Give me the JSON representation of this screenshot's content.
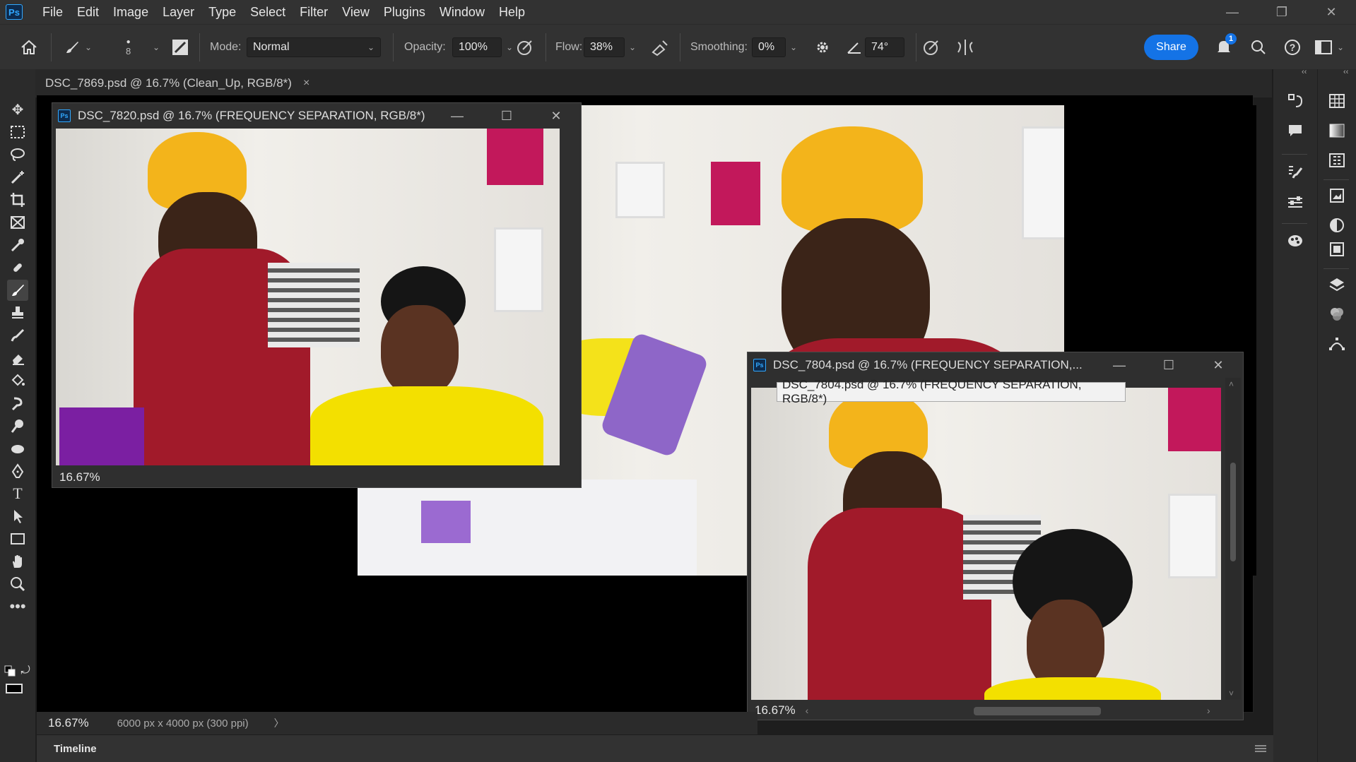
{
  "app": {
    "logo_text": "Ps",
    "accent": "#31a8ff",
    "share_color": "#1473e6"
  },
  "menu": [
    "File",
    "Edit",
    "Image",
    "Layer",
    "Type",
    "Select",
    "Filter",
    "View",
    "Plugins",
    "Window",
    "Help"
  ],
  "options": {
    "brush_size": "8",
    "mode_label": "Mode:",
    "mode_value": "Normal",
    "opacity_label": "Opacity:",
    "opacity_value": "100%",
    "flow_label": "Flow:",
    "flow_value": "38%",
    "smoothing_label": "Smoothing:",
    "smoothing_value": "0%",
    "angle_value": "74°",
    "share_label": "Share",
    "notification_count": "1"
  },
  "tabs": {
    "active_title": "DSC_7869.psd @ 16.7% (Clean_Up, RGB/8*)",
    "close_glyph": "×"
  },
  "windows": {
    "win1": {
      "title": "DSC_7820.psd @ 16.7% (FREQUENCY SEPARATION, RGB/8*)",
      "zoom": "16.67%"
    },
    "win2": {
      "title": "DSC_7804.psd @ 16.7% (FREQUENCY SEPARATION,...",
      "zoom": "16.67%",
      "tooltip": "DSC_7804.psd @ 16.7% (FREQUENCY SEPARATION, RGB/8*)"
    }
  },
  "status": {
    "zoom": "16.67%",
    "doc_info": "6000 px x 4000 px (300 ppi)"
  },
  "timeline": {
    "label": "Timeline"
  }
}
